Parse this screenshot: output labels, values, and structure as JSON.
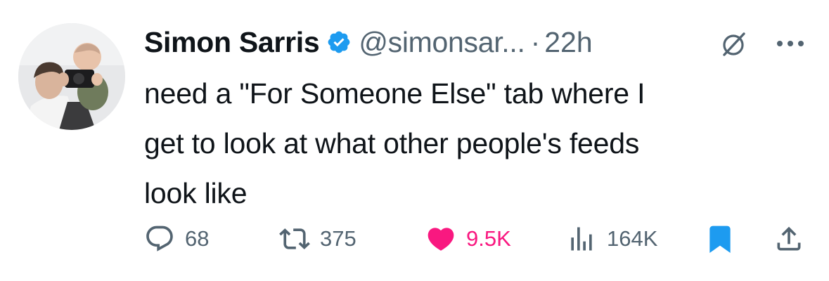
{
  "tweet": {
    "author": {
      "display_name": "Simon Sarris",
      "handle": "@simonsar...",
      "verified": true
    },
    "separator": "·",
    "time": "22h",
    "text_lines": [
      "need a \"For Someone Else\" tab where I",
      "get to look at what other people's feeds",
      "look like"
    ],
    "metrics": {
      "replies": "68",
      "retweets": "375",
      "likes": "9.5K",
      "views": "164K"
    },
    "liked": true,
    "bookmarked": true
  },
  "colors": {
    "text_primary": "#0f1419",
    "text_secondary": "#536471",
    "like_pink": "#f91880",
    "verified_blue": "#1d9bf0",
    "bookmark_blue": "#1d9bf0"
  },
  "icons": {
    "verified": "verified-badge-icon",
    "grok": "grok-icon",
    "more": "more-options-icon",
    "reply": "reply-icon",
    "retweet": "retweet-icon",
    "like": "heart-icon",
    "views": "views-icon",
    "bookmark": "bookmark-icon",
    "share": "share-icon"
  }
}
